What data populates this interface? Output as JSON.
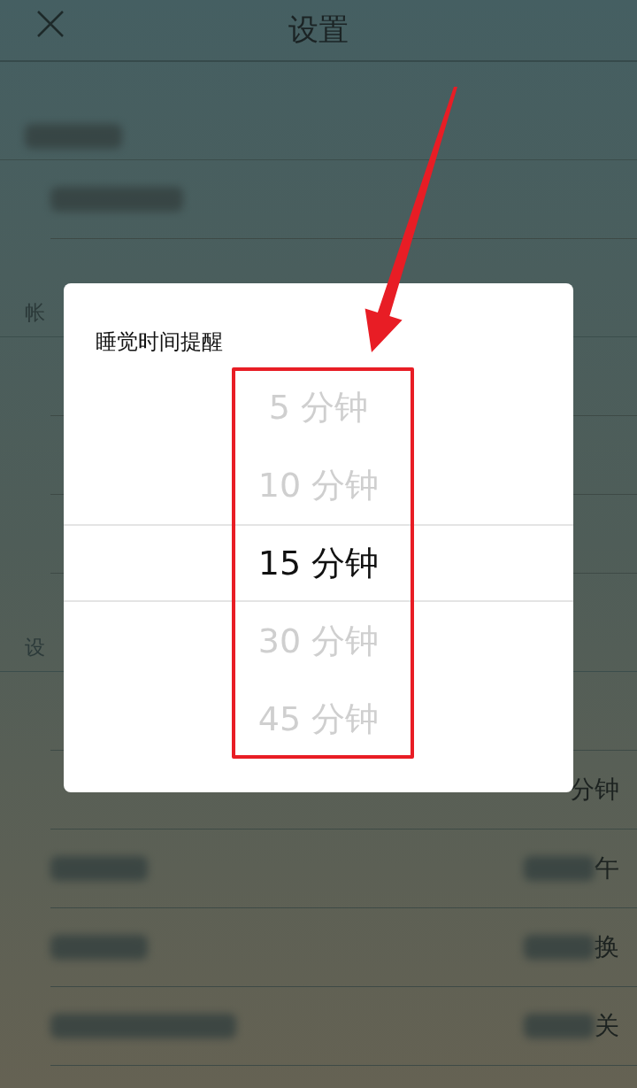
{
  "header": {
    "title": "设置"
  },
  "settings_list": [
    {
      "kind": "section",
      "blurred": true
    },
    {
      "kind": "row",
      "blurred": true
    },
    {
      "kind": "section",
      "label": "帐"
    },
    {
      "kind": "row"
    },
    {
      "kind": "row"
    },
    {
      "kind": "row"
    },
    {
      "kind": "section",
      "label": "设"
    },
    {
      "kind": "row"
    },
    {
      "kind": "row",
      "value": "分钟"
    },
    {
      "kind": "row",
      "value": "午",
      "blurred": true
    },
    {
      "kind": "row",
      "value": "换",
      "blurred": true
    },
    {
      "kind": "row",
      "value": "关",
      "blurred": true
    }
  ],
  "dialog": {
    "title": "睡觉时间提醒",
    "options": [
      {
        "label": "5 分钟",
        "selected": false
      },
      {
        "label": "10 分钟",
        "selected": false
      },
      {
        "label": "15 分钟",
        "selected": true
      },
      {
        "label": "30 分钟",
        "selected": false
      },
      {
        "label": "45 分钟",
        "selected": false
      }
    ]
  }
}
